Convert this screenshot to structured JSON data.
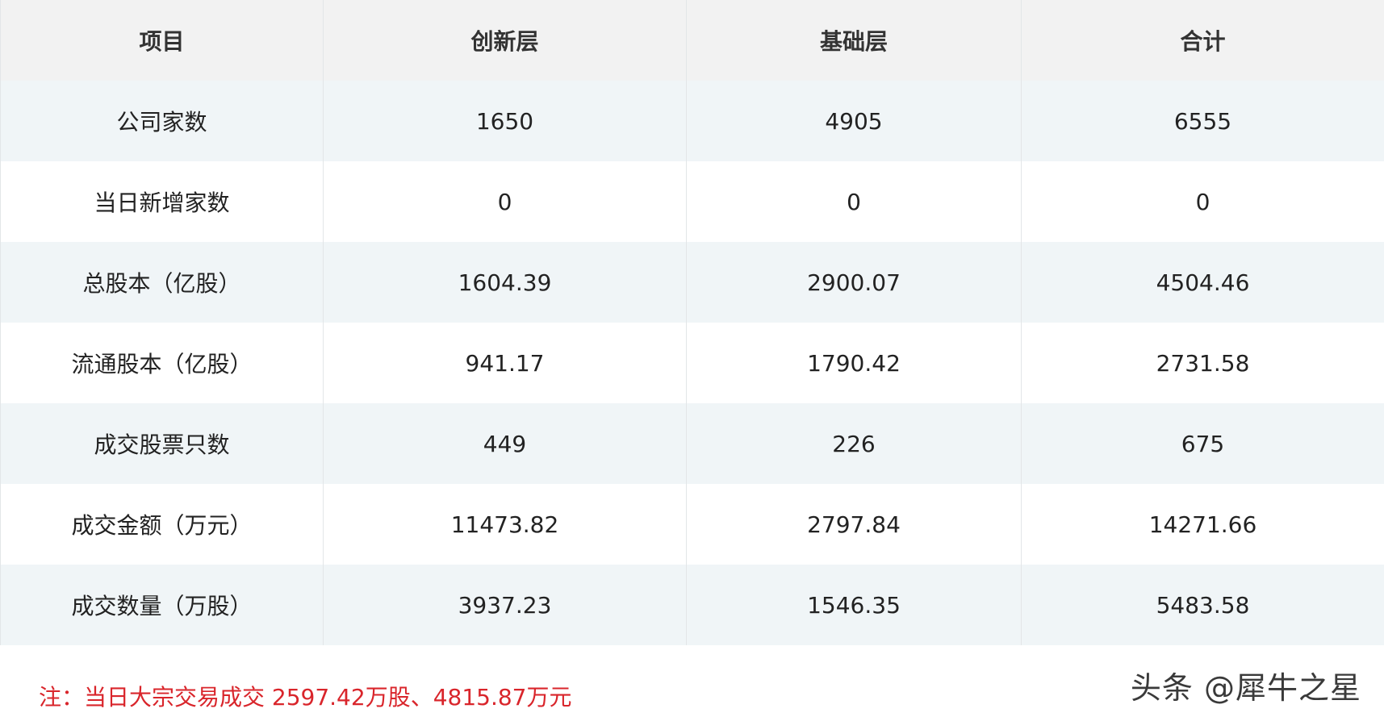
{
  "table": {
    "headers": [
      "项目",
      "创新层",
      "基础层",
      "合计"
    ],
    "rows": [
      [
        "公司家数",
        "1650",
        "4905",
        "6555"
      ],
      [
        "当日新增家数",
        "0",
        "0",
        "0"
      ],
      [
        "总股本（亿股）",
        "1604.39",
        "2900.07",
        "4504.46"
      ],
      [
        "流通股本（亿股）",
        "941.17",
        "1790.42",
        "2731.58"
      ],
      [
        "成交股票只数",
        "449",
        "226",
        "675"
      ],
      [
        "成交金额（万元）",
        "11473.82",
        "2797.84",
        "14271.66"
      ],
      [
        "成交数量（万股）",
        "3937.23",
        "1546.35",
        "5483.58"
      ]
    ]
  },
  "note": "注：当日大宗交易成交 2597.42万股、4815.87万元",
  "watermark": "头条 @犀牛之星",
  "colors": {
    "header_bg": "#f2f2f2",
    "stripe_bg": "#f0f5f7",
    "note_color": "#d9252b"
  }
}
